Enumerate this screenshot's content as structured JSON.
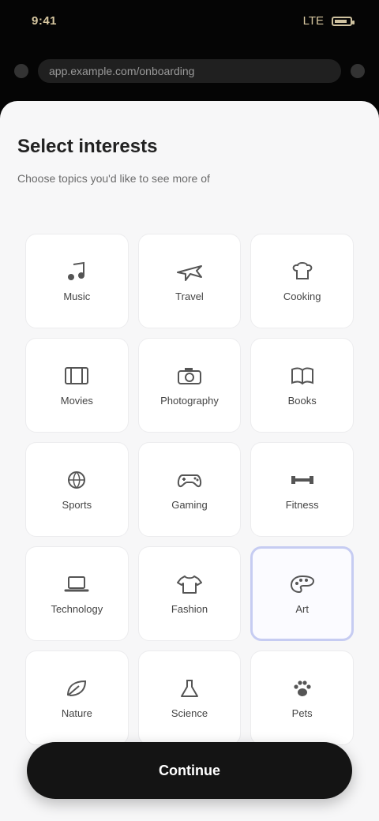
{
  "status_bar": {
    "time": "9:41",
    "signal": "LTE"
  },
  "browser": {
    "url": "app.example.com/onboarding"
  },
  "onboarding": {
    "title": "Select interests",
    "subtitle": "Choose topics you'd like to see more of",
    "tiles": [
      {
        "label": "Music",
        "icon": "music-icon",
        "selected": false
      },
      {
        "label": "Travel",
        "icon": "plane-icon",
        "selected": false
      },
      {
        "label": "Cooking",
        "icon": "chef-icon",
        "selected": false
      },
      {
        "label": "Movies",
        "icon": "film-icon",
        "selected": false
      },
      {
        "label": "Photography",
        "icon": "camera-icon",
        "selected": false
      },
      {
        "label": "Books",
        "icon": "book-icon",
        "selected": false
      },
      {
        "label": "Sports",
        "icon": "ball-icon",
        "selected": false
      },
      {
        "label": "Gaming",
        "icon": "controller-icon",
        "selected": false
      },
      {
        "label": "Fitness",
        "icon": "dumbbell-icon",
        "selected": false
      },
      {
        "label": "Technology",
        "icon": "laptop-icon",
        "selected": false
      },
      {
        "label": "Fashion",
        "icon": "shirt-icon",
        "selected": false
      },
      {
        "label": "Art",
        "icon": "palette-icon",
        "selected": true
      },
      {
        "label": "Nature",
        "icon": "leaf-icon",
        "selected": false
      },
      {
        "label": "Science",
        "icon": "flask-icon",
        "selected": false
      },
      {
        "label": "Pets",
        "icon": "paw-icon",
        "selected": false
      }
    ],
    "cta_label": "Continue"
  },
  "colors": {
    "sheet": "#f7f7f8",
    "tile": "#ffffff",
    "selected_border": "#c6ccf2",
    "cta_bg": "#141414",
    "cta_text": "#ffffff"
  }
}
